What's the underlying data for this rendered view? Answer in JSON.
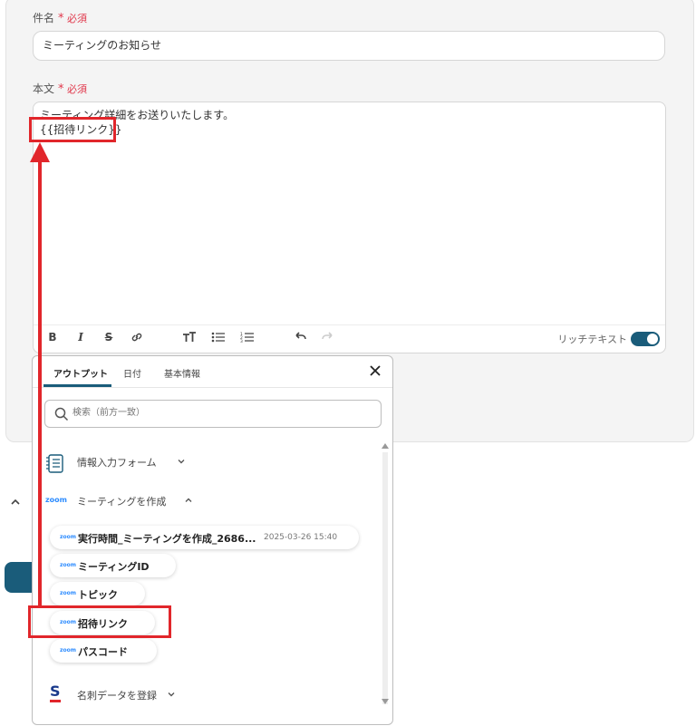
{
  "subject": {
    "label": "件名",
    "required": "必須",
    "value": "ミーティングのお知らせ"
  },
  "body": {
    "label": "本文",
    "required": "必須",
    "line1": "ミーティング詳細をお送りいたします。",
    "line2": "{{招待リンク}}",
    "rich_text_label": "リッチテキスト",
    "rich_text_on": true
  },
  "toolbar": {
    "icons": [
      "bold-icon",
      "italic-icon",
      "strikethrough-icon",
      "link-icon",
      "text-size-icon",
      "bullet-list-icon",
      "numbered-list-icon",
      "undo-icon",
      "redo-icon"
    ],
    "bold": "B",
    "italic": "I",
    "strike": "S"
  },
  "dropdown": {
    "tabs": [
      "アウトプット",
      "日付",
      "基本情報"
    ],
    "active_tab": "アウトプット",
    "search_placeholder": "検索（前方一致）",
    "groups": {
      "form": "情報入力フォーム",
      "zoom": "ミーティングを作成",
      "meishi": "名刺データを登録"
    },
    "zoom_logo": "zoom",
    "items": [
      {
        "name": "実行時間_ミーティングを作成_2686...",
        "value": "2025-03-26 15:40"
      },
      {
        "name": "ミーティングID",
        "value": ""
      },
      {
        "name": "トピック",
        "value": ""
      },
      {
        "name": "招待リンク",
        "value": ""
      },
      {
        "name": "パスコード",
        "value": ""
      }
    ]
  },
  "colors": {
    "accent": "#1a5c7a",
    "highlight": "#e1262b",
    "required": "#e0364a",
    "zoom": "#2d8cff"
  }
}
